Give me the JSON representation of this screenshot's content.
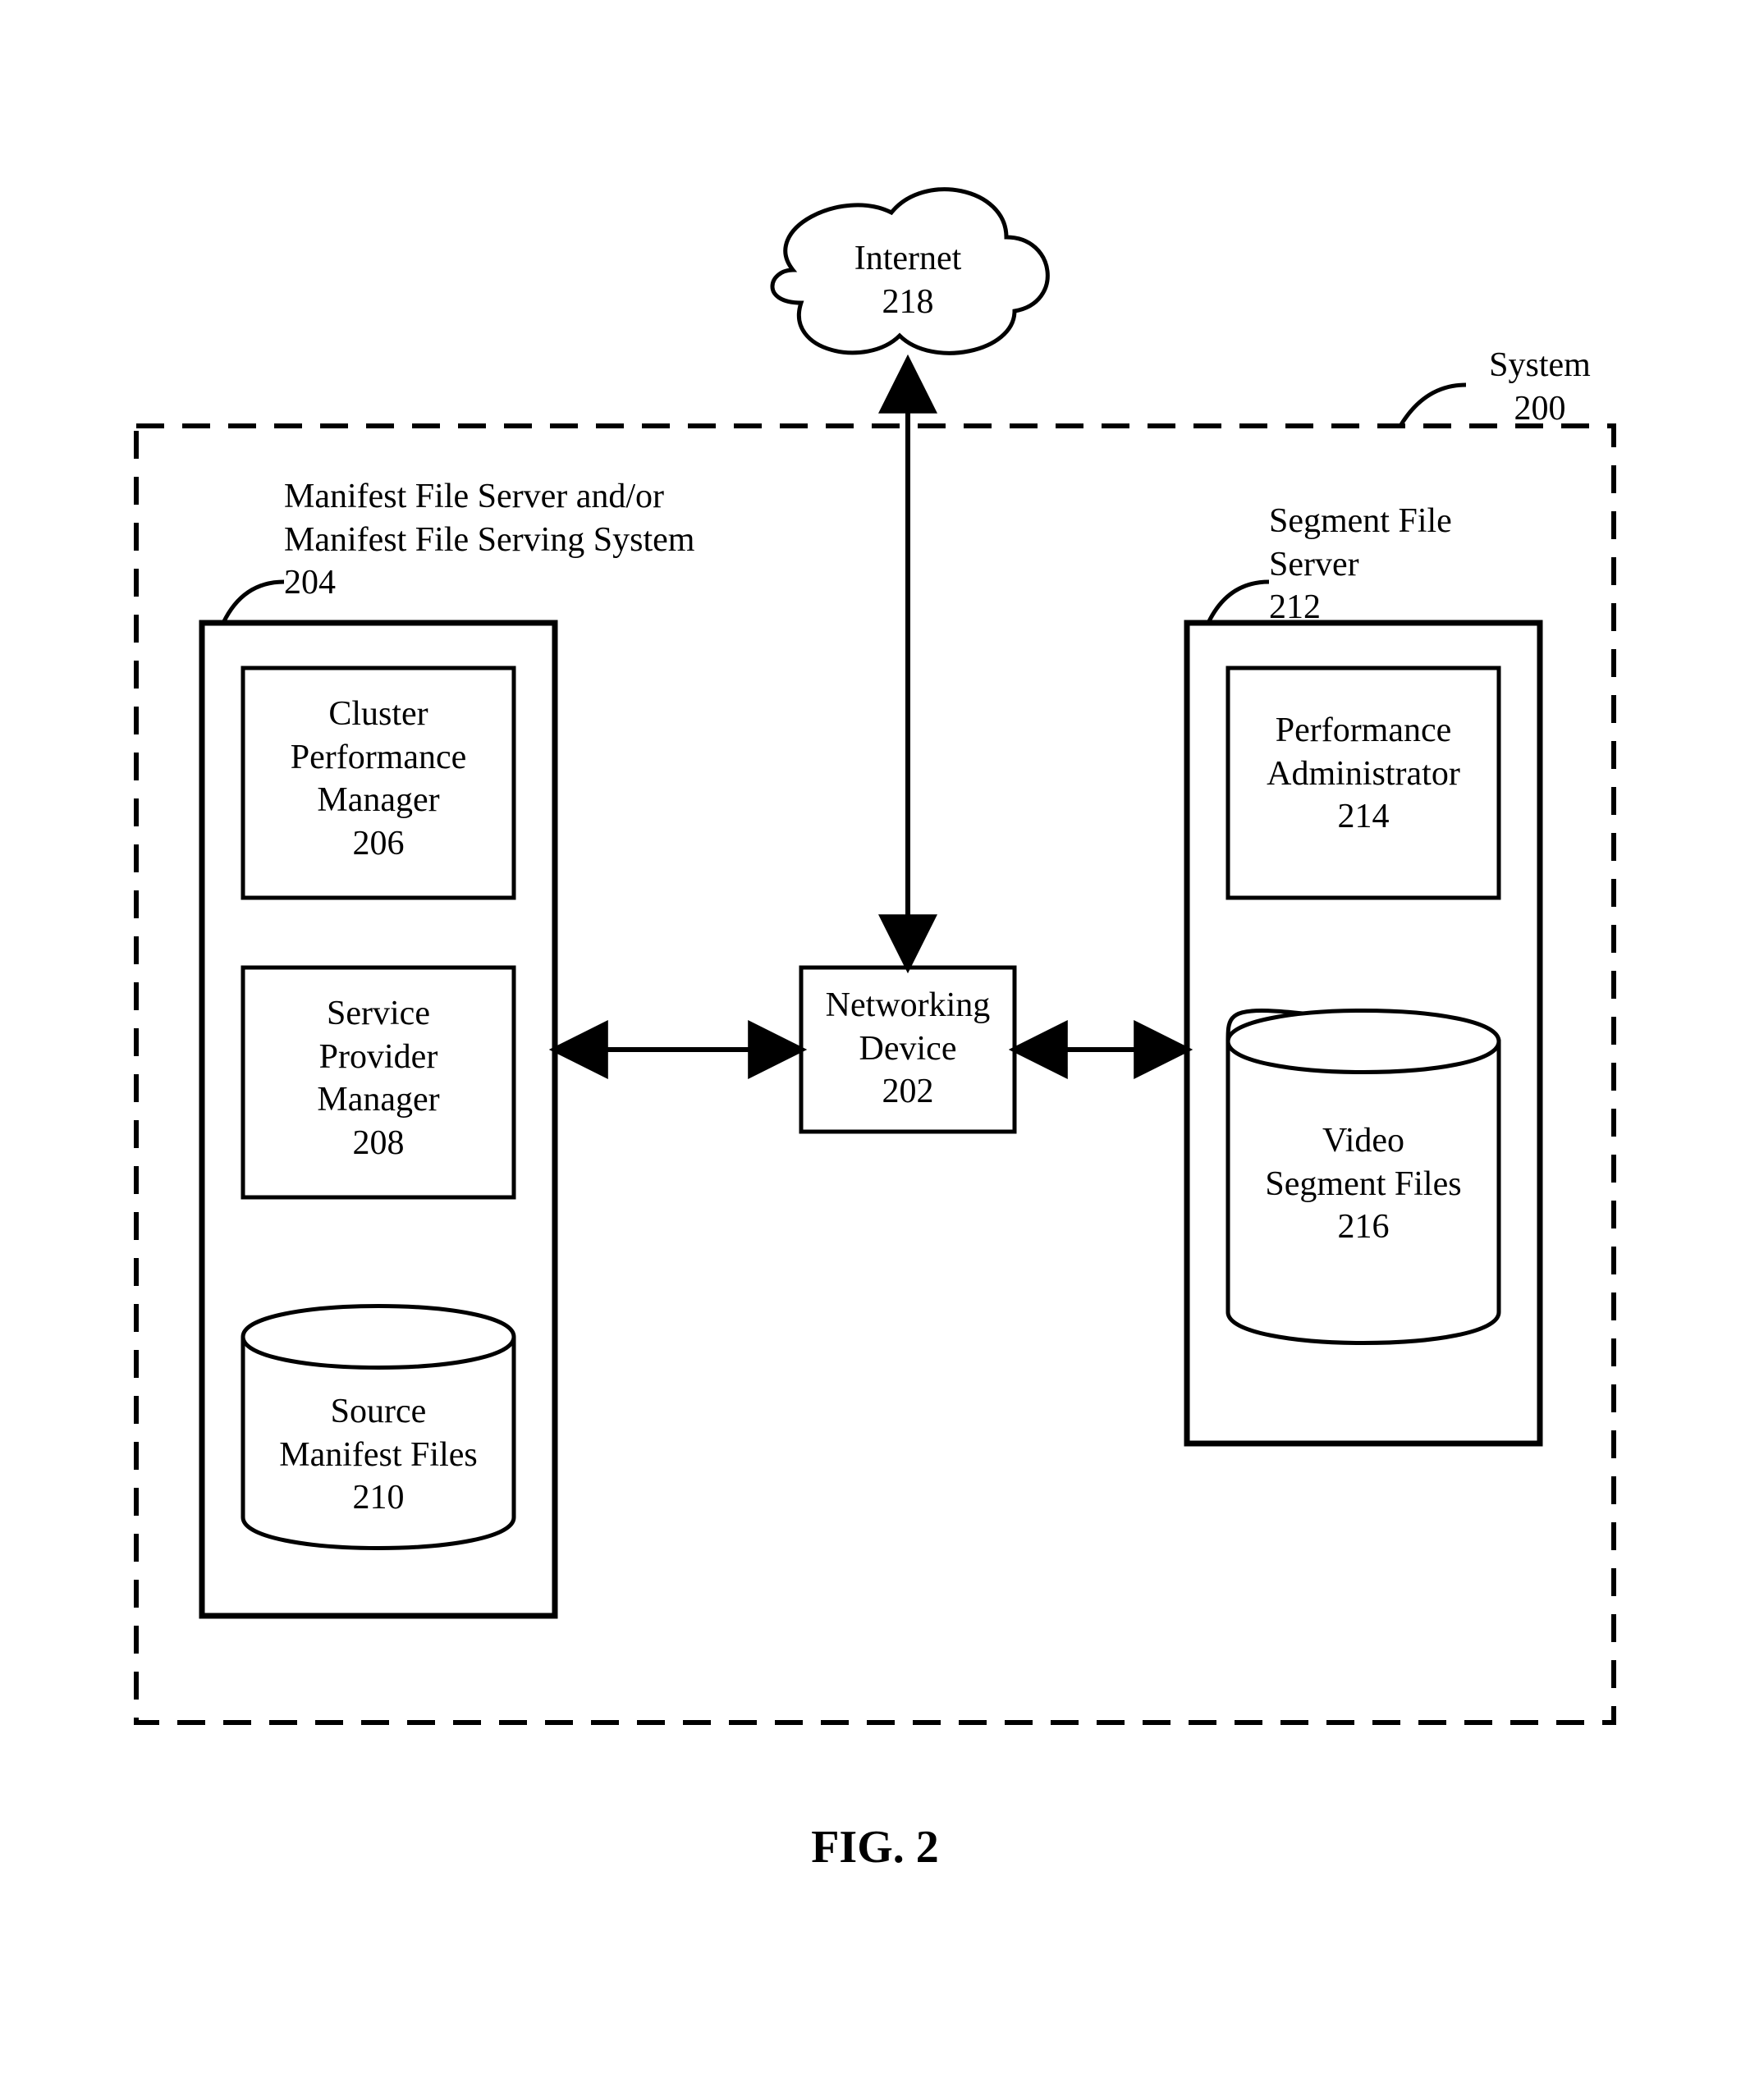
{
  "figure_caption": "FIG. 2",
  "system": {
    "label": "System\n200"
  },
  "internet": {
    "label": "Internet\n218"
  },
  "networking_device": {
    "label": "Networking\nDevice\n202"
  },
  "manifest_server": {
    "label": "Manifest File Server and/or\nManifest File Serving System\n204",
    "cluster_perf_mgr": "Cluster\nPerformance\nManager\n206",
    "service_provider_mgr": "Service\nProvider\nManager\n208",
    "source_manifest_files": "Source\nManifest Files\n210"
  },
  "segment_server": {
    "label": "Segment File\nServer\n212",
    "perf_admin": "Performance\nAdministrator\n214",
    "video_segment_files": "Video\nSegment Files\n216"
  }
}
